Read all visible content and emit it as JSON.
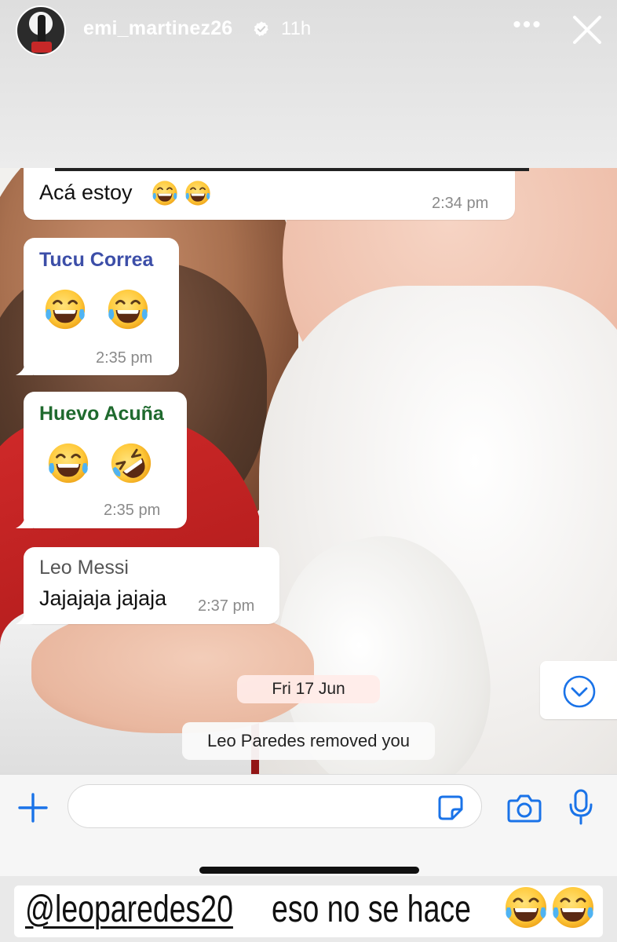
{
  "story_header": {
    "username": "emi_martinez26",
    "time_ago": "11h",
    "more_label": "•••",
    "icons": [
      "verified-icon",
      "more-icon",
      "close-icon"
    ]
  },
  "chat": {
    "messages": [
      {
        "sender": "",
        "text": "Acá estoy",
        "emoji": [
          "😂",
          "😂"
        ],
        "time": "2:34 pm"
      },
      {
        "sender": "Tucu Correa",
        "sender_color": "#3c4ea8",
        "text": "",
        "emoji": [
          "😂",
          "😂"
        ],
        "time": "2:35 pm"
      },
      {
        "sender": "Huevo Acuña",
        "sender_color": "#1f6a2e",
        "text": "",
        "emoji": [
          "😂",
          "🤣"
        ],
        "time": "2:35 pm"
      },
      {
        "sender": "Leo Messi",
        "sender_color": "#555555",
        "text": "Jajajaja jajaja",
        "emoji": [],
        "time": "2:37 pm"
      }
    ],
    "date_divider": "Fri 17 Jun",
    "system_message": "Leo Paredes removed you"
  },
  "input_bar": {
    "value": "",
    "placeholder": "",
    "icons": [
      "plus-icon",
      "sticker-icon",
      "camera-icon",
      "mic-icon"
    ],
    "accent_color": "#1a73e8"
  },
  "caption": {
    "mention": "@leoparedes20",
    "text": "eso no se hace",
    "emoji": [
      "😂",
      "😂"
    ]
  }
}
